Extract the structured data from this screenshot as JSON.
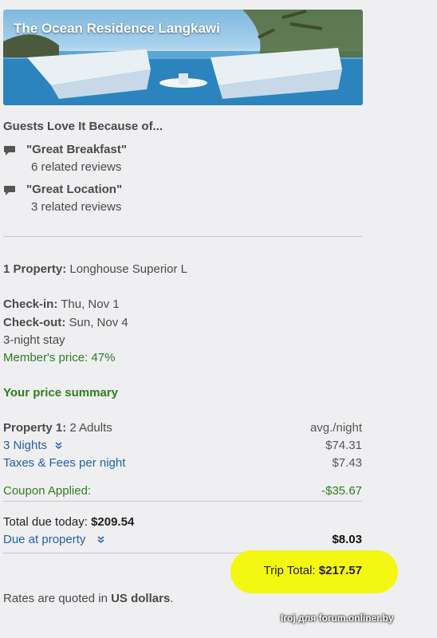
{
  "hero": {
    "title": "The Ocean Residence Langkawi"
  },
  "guests_love": {
    "heading": "Guests Love It Because of...",
    "reasons": [
      {
        "quote": "\"Great Breakfast\"",
        "count": "6 related reviews"
      },
      {
        "quote": "\"Great Location\"",
        "count": "3 related reviews"
      }
    ]
  },
  "booking": {
    "property_label": "1 Property:",
    "property_value": "Longhouse Superior L",
    "checkin_label": "Check-in:",
    "checkin_value": "Thu, Nov 1",
    "checkout_label": "Check-out:",
    "checkout_value": "Sun, Nov 4",
    "stay": "3-night stay",
    "member_price": "Member's price: 47%"
  },
  "summary": {
    "heading": "Your price summary",
    "property_label": "Property 1:",
    "property_value": "2 Adults",
    "avg_label": "avg./night",
    "nights_label": "3 Nights",
    "nights_value": "$74.31",
    "taxes_label": "Taxes & Fees per night",
    "taxes_value": "$7.43",
    "coupon_label": "Coupon Applied:",
    "coupon_value": "-$35.67",
    "due_today_label": "Total due today:",
    "due_today_value": "$209.54",
    "due_property_label": "Due at property",
    "due_property_value": "$8.03",
    "trip_total_label": "Trip Total:",
    "trip_total_value": "$217.57",
    "rates_note_prefix": "Rates are quoted in ",
    "rates_note_bold": "US dollars",
    "rates_note_suffix": "."
  },
  "watermark": "Iroj для forum.onliner.by",
  "colors": {
    "green": "#2f7d1e",
    "blue": "#1f63a8",
    "highlight": "#f4f711"
  }
}
